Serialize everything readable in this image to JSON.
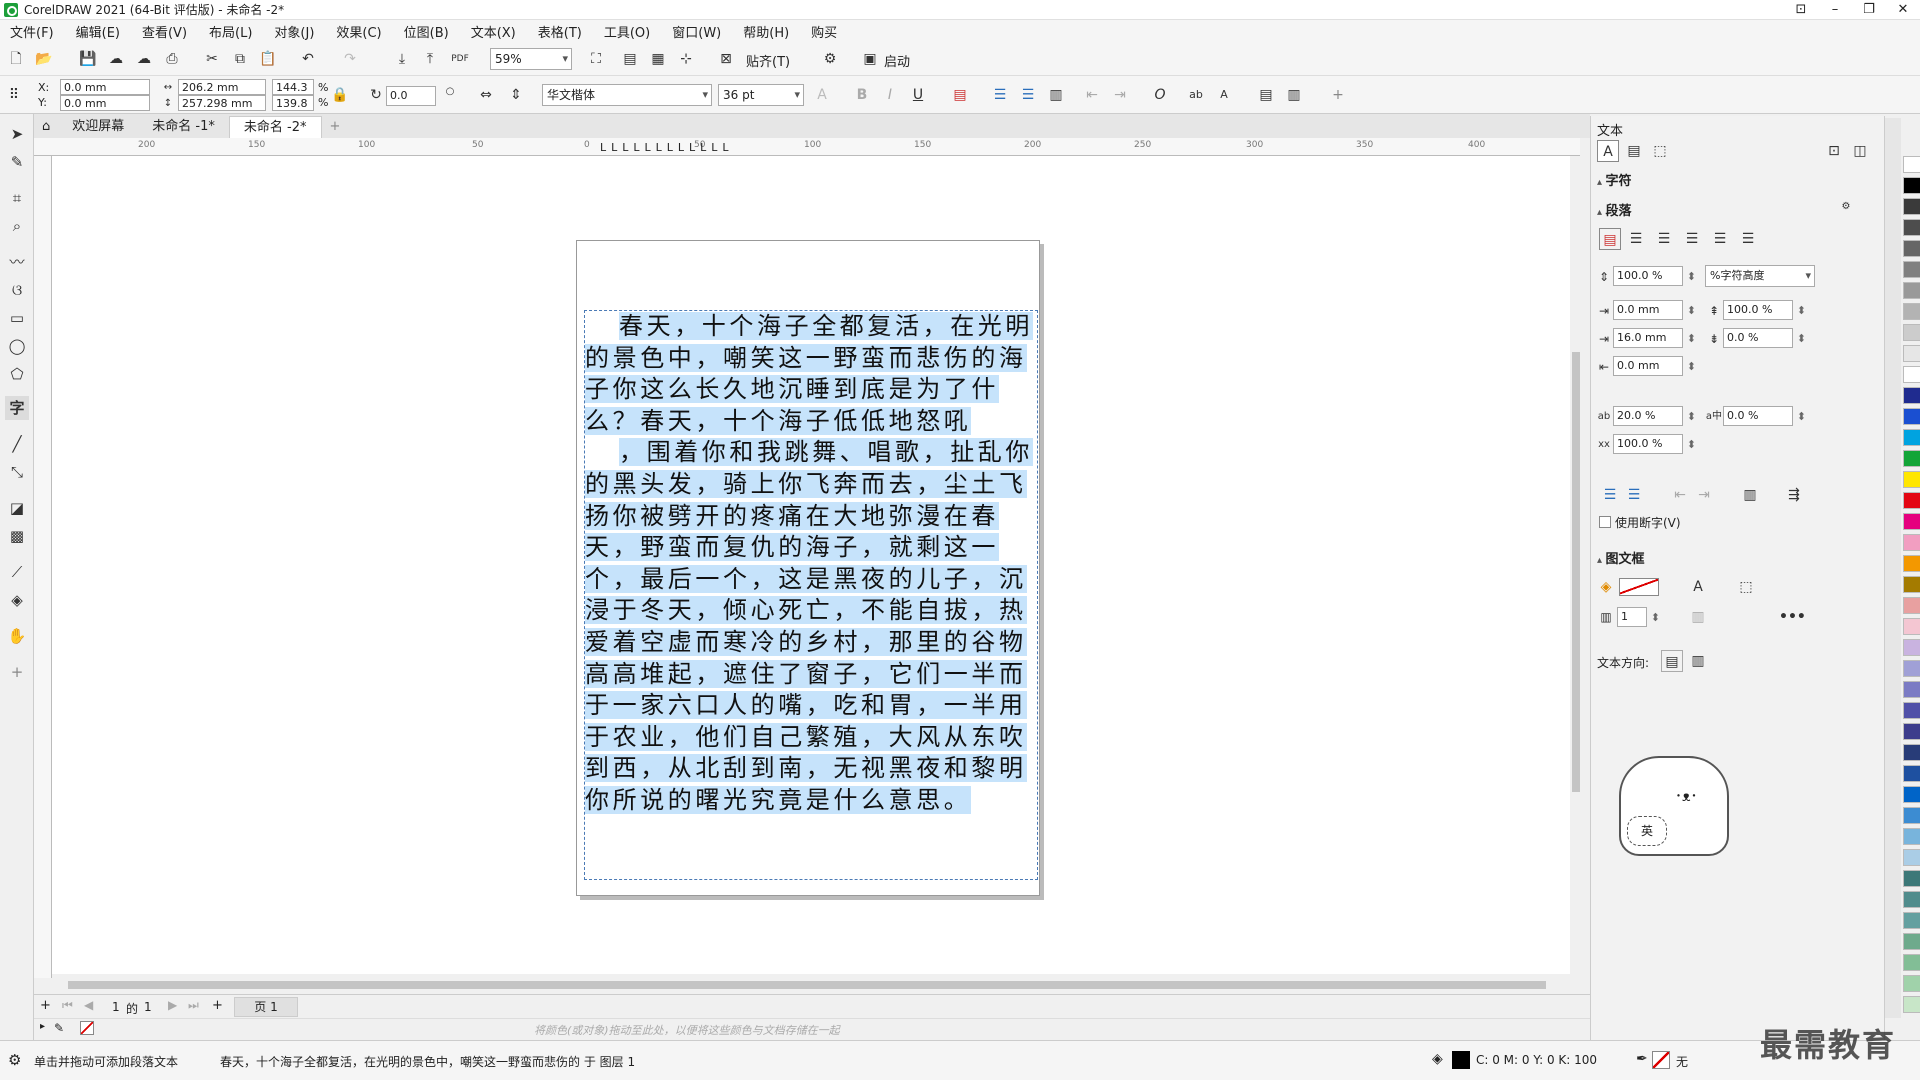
{
  "window": {
    "title": "CorelDRAW 2021 (64-Bit 评估版) - 未命名 -2*"
  },
  "menu": [
    "文件(F)",
    "编辑(E)",
    "查看(V)",
    "布局(L)",
    "对象(J)",
    "效果(C)",
    "位图(B)",
    "文本(X)",
    "表格(T)",
    "工具(O)",
    "窗口(W)",
    "帮助(H)",
    "购买"
  ],
  "toolbar": {
    "zoom": "59%",
    "snap_label": "贴齐(T)",
    "launch_label": "启动"
  },
  "propbar": {
    "x_label": "X:",
    "x": "0.0 mm",
    "y_label": "Y:",
    "y": "0.0 mm",
    "width": "206.2 mm",
    "height": "257.298 mm",
    "scale_w": "144.3",
    "scale_h": "139.8",
    "pct": "%",
    "rotation": "0.0",
    "font": "华文楷体",
    "font_size": "36 pt"
  },
  "tabs": [
    "欢迎屏幕",
    "未命名 -1*",
    "未命名 -2*"
  ],
  "ruler_top_labels": [
    "200",
    "150",
    "100",
    "50",
    "0",
    "50",
    "100",
    "150",
    "200",
    "250",
    "300",
    "350",
    "400"
  ],
  "text_content": {
    "p1": "春天，十个海子全都复活，在光明的景色中，嘲笑这一野蛮而悲伤的海子你这么长久地沉睡到底是为了什么？春天，十个海子低低地怒吼",
    "p2": "，围着你和我跳舞、唱歌，扯乱你的黑头发，骑上你飞奔而去，尘土飞扬你被劈开的疼痛在大地弥漫在春天，野蛮而复仇的海子，就剩这一个，最后一个，这是黑夜的儿子，沉浸于冬天，倾心死亡，不能自拔，热爱着空虚而寒冷的乡村，那里的谷物高高堆起，遮住了窗子，它们一半而于一家六口人的嘴，吃和胃，一半用于农业，他们自己繁殖，大风从东吹到西，从北刮到南，无视黑夜和黎明你所说的曙光究竟是什么意思。"
  },
  "pagenav": {
    "position": "1",
    "of_label": "的",
    "total": "1",
    "page_tab": "页 1"
  },
  "colorstrip_hint": "将颜色(或对象)拖动至此处，以便将这些颜色与文档存储在一起",
  "status": {
    "hint": "单击并拖动可添加段落文本",
    "info": "春天，十个海子全都复活，在光明的景色中，嘲笑这一野蛮而悲伤的 于 图层 1",
    "cmyk": "C: 0 M: 0 Y: 0 K: 100",
    "none_label": "无"
  },
  "panel": {
    "title": "文本",
    "char_section": "字符",
    "para_section": "段落",
    "line_spacing": "100.0 %",
    "line_spacing_unit": "%字符高度",
    "left_indent": "0.0 mm",
    "first_indent": "16.0 mm",
    "right_indent": "0.0 mm",
    "before_para": "100.0 %",
    "after_para": "0.0 %",
    "char_spacing": "20.0 %",
    "lang_spacing": "0.0 %",
    "word_spacing": "100.0 %",
    "hyphen_label": "使用断字(V)",
    "frame_section": "图文框",
    "columns": "1",
    "direction_label": "文本方向:"
  },
  "watermark": {
    "text": "最需教育",
    "mascot_text": "英"
  },
  "palette": [
    "#ffffff",
    "#000000",
    "#3a3a3a",
    "#4d4d4d",
    "#666666",
    "#808080",
    "#999999",
    "#b3b3b3",
    "#cccccc",
    "#e6e6e6",
    "#ffffff",
    "#1f2b8f",
    "#1a4fd1",
    "#00a3e0",
    "#13a538",
    "#ffe600",
    "#e30613",
    "#e5007e",
    "#f29ec1",
    "#f39800",
    "#a47b00",
    "#e8a0a0",
    "#f4c6d2",
    "#c9b3e0",
    "#a0a0d6",
    "#7b7bc4",
    "#5050a8",
    "#3c3c8c",
    "#283c78",
    "#1e50a0",
    "#0064c8",
    "#3c8cd2",
    "#78b4dc",
    "#aacde6",
    "#3c7878",
    "#508c8c",
    "#64a0a0",
    "#6eaa8c",
    "#82be96",
    "#a0d2aa",
    "#c8e6c8"
  ]
}
